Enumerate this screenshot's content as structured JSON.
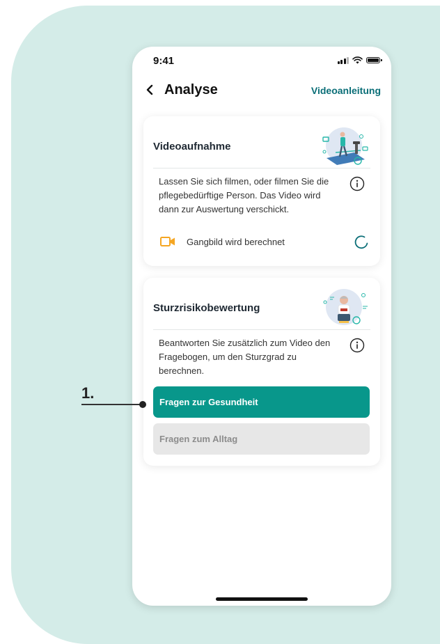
{
  "status_bar": {
    "time": "9:41"
  },
  "nav": {
    "title": "Analyse",
    "video_link": "Videoanleitung"
  },
  "card_video": {
    "title": "Videoaufnahme",
    "description": "Lassen Sie sich filmen, oder filmen Sie die pflegebedürftige Person. Das Video wird dann zur Auswertung verschickt.",
    "status_text": "Gangbild wird berechnet",
    "status_icon": "video-camera-icon",
    "status_icon_color": "#f5a623"
  },
  "card_fall": {
    "title": "Sturzrisikobewertung",
    "description": "Beantworten Sie zusätzlich zum Video den Fragebogen, um den  Sturzgrad zu berechnen.",
    "button_health": "Fragen zur Gesundheit",
    "button_daily": "Fragen zum Alltag"
  },
  "annotation": {
    "label": "1."
  },
  "colors": {
    "accent": "#08978b",
    "link": "#0a6e77",
    "background": "#d4ece8"
  }
}
